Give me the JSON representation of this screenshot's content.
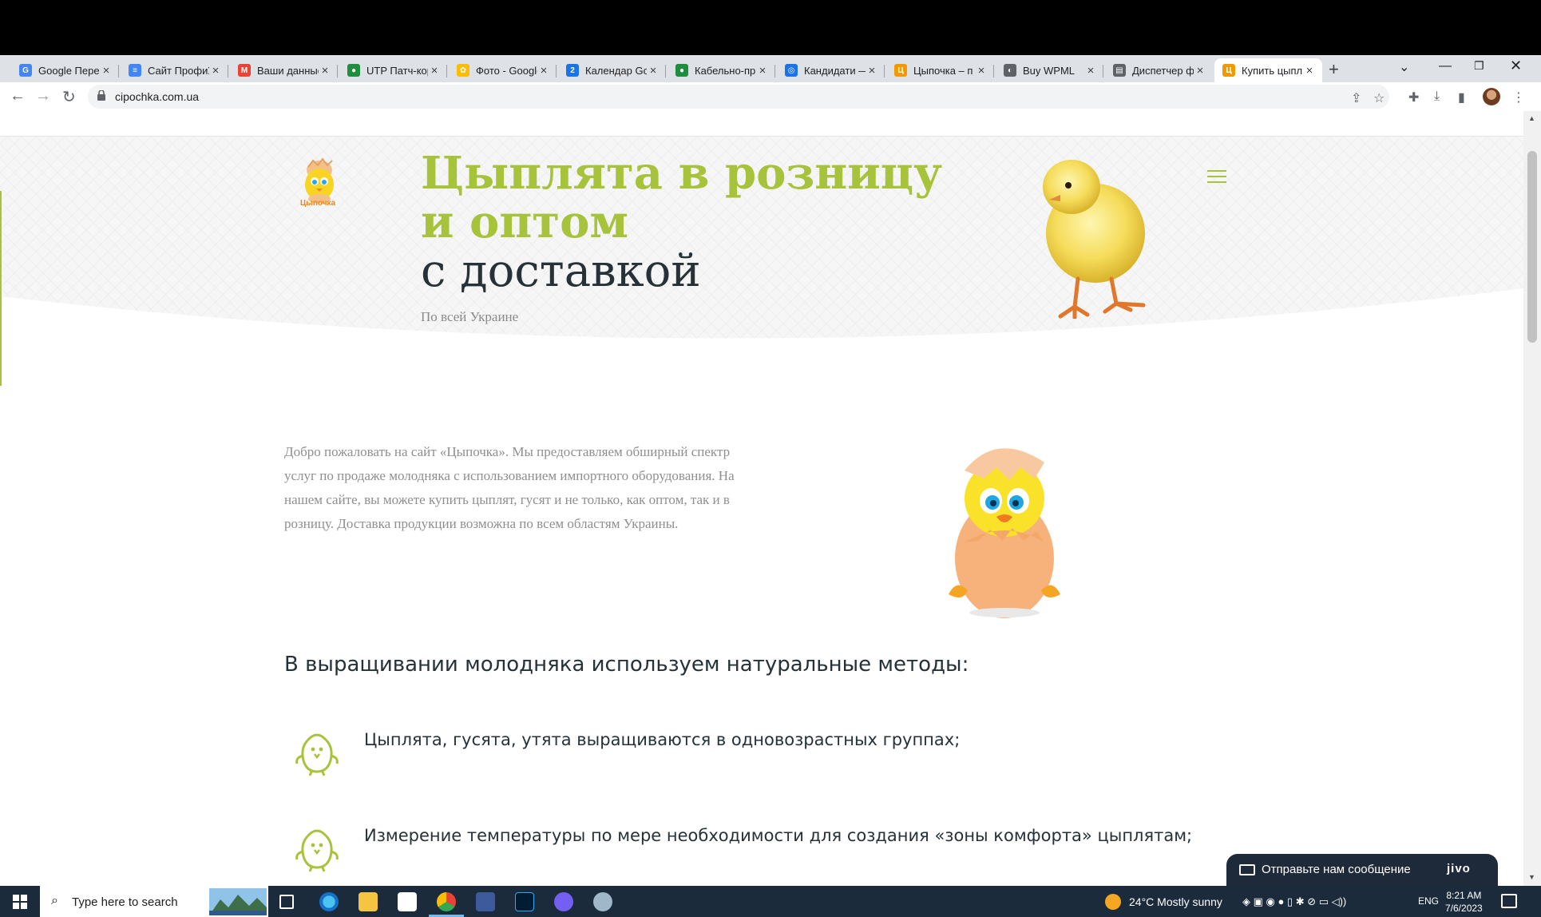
{
  "browser": {
    "tabs": [
      {
        "title": "Google Переводчик",
        "favicon_color": "#4285f4",
        "favicon_glyph": "G"
      },
      {
        "title": "Сайт ПрофиУм",
        "favicon_color": "#4285f4",
        "favicon_glyph": "≡"
      },
      {
        "title": "Ваши данные",
        "favicon_color": "#ea4335",
        "favicon_glyph": "M"
      },
      {
        "title": "UTP Патч-корд",
        "favicon_color": "#1e8e3e",
        "favicon_glyph": "●"
      },
      {
        "title": "Фото - Google",
        "favicon_color": "#fbbc04",
        "favicon_glyph": "✿"
      },
      {
        "title": "Календар Google",
        "favicon_color": "#1a73e8",
        "favicon_glyph": "2"
      },
      {
        "title": "Кабельно-пр",
        "favicon_color": "#1e8e3e",
        "favicon_glyph": "●"
      },
      {
        "title": "Кандидати —",
        "favicon_color": "#1a73e8",
        "favicon_glyph": "◎"
      },
      {
        "title": "Цыпочка – п",
        "favicon_color": "#f29900",
        "favicon_glyph": "Ц"
      },
      {
        "title": "Buy WPML",
        "favicon_color": "#5f6368",
        "favicon_glyph": "◐"
      },
      {
        "title": "Диспетчер ф",
        "favicon_color": "#5f6368",
        "favicon_glyph": "▤"
      },
      {
        "title": "Купить цыпл",
        "favicon_color": "#f29900",
        "favicon_glyph": "Ц",
        "active": true
      }
    ],
    "new_tab_glyph": "+",
    "url": "cipochka.com.ua"
  },
  "page": {
    "logo_text": "Цыпочка",
    "hero_title_line1": "Цыплята в розницу",
    "hero_title_line2": "и оптом",
    "hero_title_line3": "с доставкой",
    "hero_subtitle": "По всей Украине",
    "intro": "Добро пожаловать на сайт «Цыпочка». Мы предоставляем обширный спектр услуг по продаже молодняка с использованием импортного оборудования. На нашем сайте, вы можете купить цыплят, гусят и не только, как оптом, так и в розницу. Доставка продукции возможна по всем областям Украины.",
    "methods_heading": "В выращивании молодняка используем натуральные методы:",
    "features": [
      "Цыплята, гусята, утята выращиваются в одновозрастных группах;",
      "Измерение температуры по мере необходимости для создания «зоны комфорта» цыплятам;"
    ],
    "accent_color": "#a7c23b",
    "dark_text_color": "#263238"
  },
  "chat_widget": {
    "message": "Отправьте нам сообщение",
    "brand": "jivo"
  },
  "taskbar": {
    "search_placeholder": "Type here to search",
    "weather": "24°C  Mostly sunny",
    "lang": "ENG",
    "time": "8:21 AM",
    "date": "7/6/2023"
  }
}
